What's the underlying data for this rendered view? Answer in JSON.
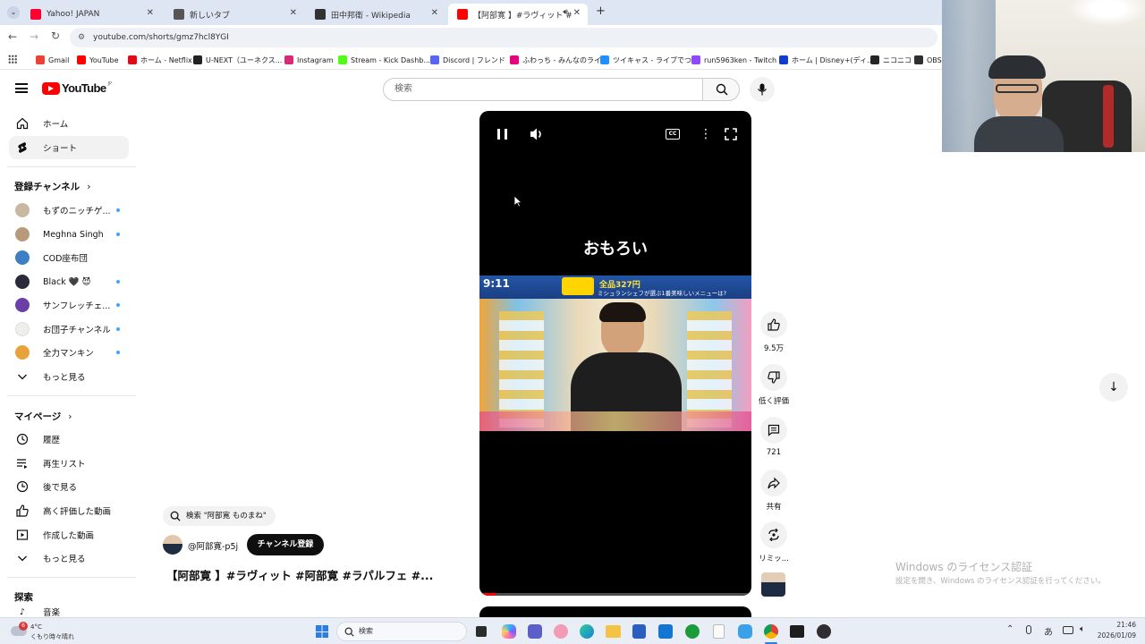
{
  "browser": {
    "tabs": [
      {
        "label": "Yahoo! JAPAN",
        "color": "#ff0033",
        "active": false
      },
      {
        "label": "新しいタブ",
        "color": "#555555",
        "active": false
      },
      {
        "label": "田中邦衛 - Wikipedia",
        "color": "#333333",
        "active": false
      },
      {
        "label": "【阿部寛 】#ラヴィット #阿部寛",
        "color": "#ff0000",
        "active": true
      }
    ],
    "new_tab": "+",
    "url": "youtube.com/shorts/gmz7hcl8YGI",
    "bookmarks": [
      {
        "label": "Gmail",
        "color": "#ea4335"
      },
      {
        "label": "YouTube",
        "color": "#ff0000"
      },
      {
        "label": "ホーム - Netflix",
        "color": "#e50914"
      },
      {
        "label": "U-NEXT（ユーネクス...",
        "color": "#222222"
      },
      {
        "label": "Instagram",
        "color": "#d62976"
      },
      {
        "label": "Stream - Kick Dashb...",
        "color": "#53fc18"
      },
      {
        "label": "Discord | フレンド",
        "color": "#5865f2"
      },
      {
        "label": "ふわっち - みんなのライ...",
        "color": "#e4007f"
      },
      {
        "label": "ツイキャス - ライブでつ...",
        "color": "#1e90ff"
      },
      {
        "label": "run5963ken - Twitch",
        "color": "#9146ff"
      },
      {
        "label": "ホーム | Disney+(ディ...",
        "color": "#113ccf"
      },
      {
        "label": "ニコニコ",
        "color": "#252525"
      },
      {
        "label": "OBS",
        "color": "#302e31"
      }
    ]
  },
  "header": {
    "logo_text": "YouTube",
    "region": "JP",
    "search_placeholder": "検索"
  },
  "sidebar": {
    "main": [
      {
        "label": "ホーム",
        "icon": "home-icon"
      },
      {
        "label": "ショート",
        "icon": "shorts-icon",
        "active": true
      }
    ],
    "subs_title": "登録チャンネル",
    "subs": [
      {
        "label": "もずのニッチゲ...",
        "color": "#c9b8a0",
        "dot": true
      },
      {
        "label": "Meghna Singh",
        "color": "#b89a7a",
        "dot": true
      },
      {
        "label": "COD座布団",
        "color": "#3d7fc4",
        "dot": false
      },
      {
        "label": "Black 🖤 😈",
        "color": "#2a2a3a",
        "dot": true
      },
      {
        "label": "サンフレッチェ...",
        "color": "#6c3fa8",
        "dot": true
      },
      {
        "label": "お団子チャンネル",
        "color": "#f0eee8",
        "dot": true
      },
      {
        "label": "全力マンキン",
        "color": "#e8a23a",
        "dot": true
      }
    ],
    "subs_more": "もっと見る",
    "you_title": "マイページ",
    "you": [
      {
        "label": "履歴",
        "icon": "history-icon"
      },
      {
        "label": "再生リスト",
        "icon": "playlist-icon"
      },
      {
        "label": "後で見る",
        "icon": "watch-later-icon"
      },
      {
        "label": "高く評価した動画",
        "icon": "thumb-up-icon"
      },
      {
        "label": "作成した動画",
        "icon": "your-videos-icon"
      },
      {
        "label": "もっと見る",
        "icon": "chevron-down-icon"
      }
    ],
    "explore_title": "探索",
    "explore_partial": "音楽"
  },
  "video": {
    "caption": "おもろい",
    "clock": "9:11",
    "banner_price": "全品327円",
    "banner_text": "ミシュランシェフが選ぶ1番美味しいメニューは?",
    "search_chip": "検索 \"阿部寛 ものまね\"",
    "channel": "@阿部寛-p5j",
    "subscribe": "チャンネル登録",
    "title": "【阿部寛 】#ラヴィット #阿部寛 #ラパルフェ #..."
  },
  "actions": {
    "likes": "9.5万",
    "dislike": "低く評価",
    "comments": "721",
    "share": "共有",
    "remix": "リミッ..."
  },
  "watermark": {
    "line1": "Windows のライセンス認証",
    "line2": "設定を開き、Windows のライセンス認証を行ってください。"
  },
  "taskbar": {
    "weather_temp": "4°C",
    "weather_desc": "くもり時々晴れ",
    "weather_badge": "6",
    "search": "検索",
    "time": "21:46",
    "date": "2026/01/09",
    "ime": "あ"
  }
}
